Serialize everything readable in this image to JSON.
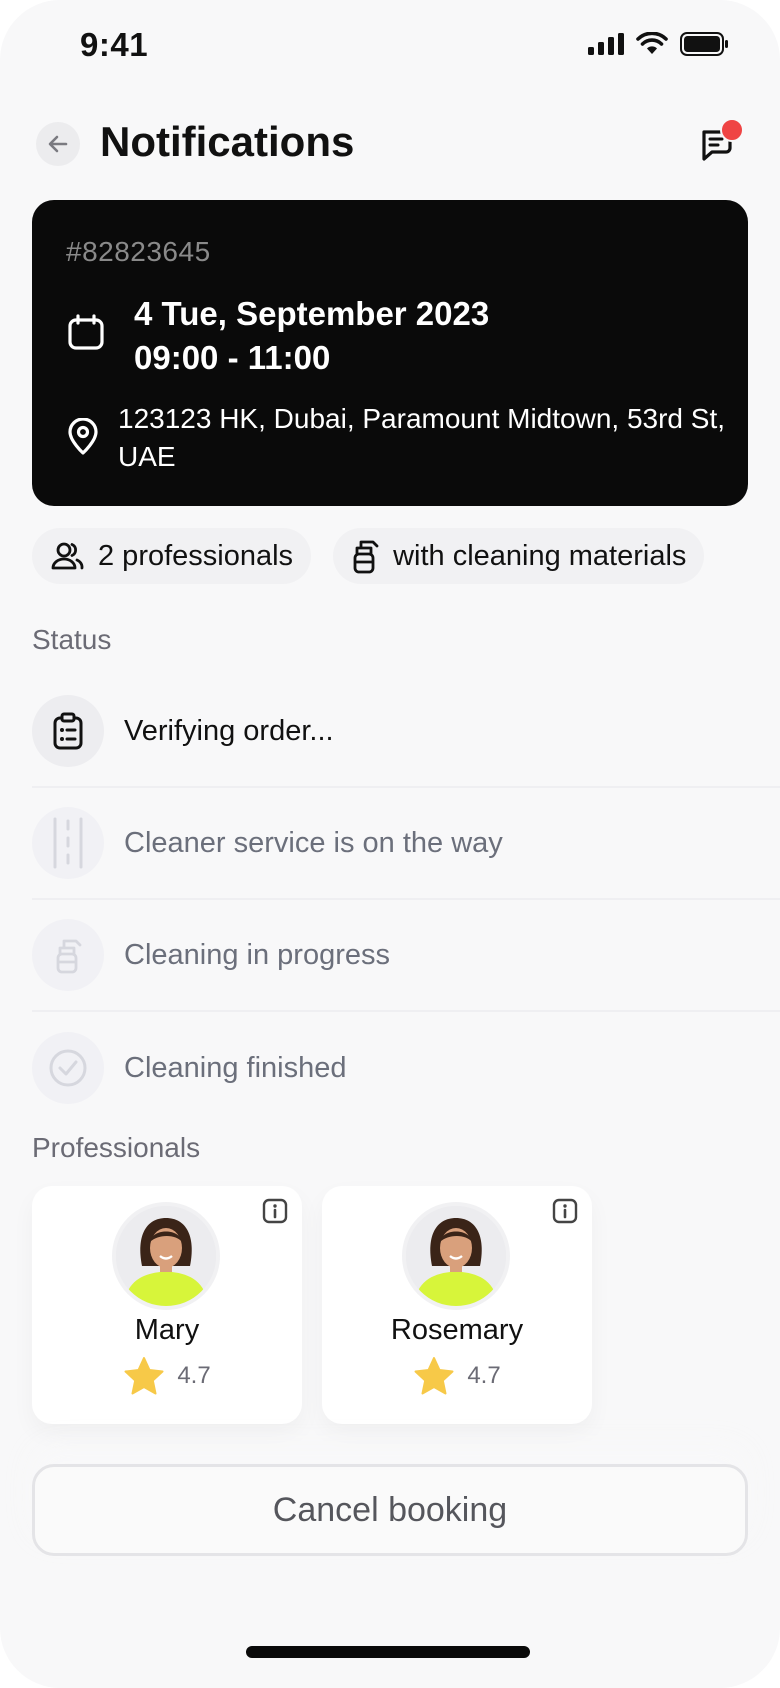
{
  "status_bar": {
    "time": "9:41"
  },
  "header": {
    "title": "Notifications",
    "has_unread": true
  },
  "booking": {
    "order_id": "#82823645",
    "date": "4 Tue, September 2023",
    "time": "09:00 - 11:00",
    "address": "123123 HK, Dubai, Paramount Midtown, 53rd St, UAE"
  },
  "chips": [
    {
      "icon": "users-icon",
      "label": "2 professionals"
    },
    {
      "icon": "spray-bottle-icon",
      "label": "with cleaning materials"
    }
  ],
  "status_section": {
    "label": "Status",
    "steps": [
      {
        "icon": "clipboard-icon",
        "label": "Verifying order...",
        "active": true
      },
      {
        "icon": "road-icon",
        "label": "Cleaner service is on the way",
        "active": false
      },
      {
        "icon": "spray-bottle-icon",
        "label": "Cleaning in progress",
        "active": false
      },
      {
        "icon": "check-circle-icon",
        "label": "Cleaning finished",
        "active": false
      }
    ]
  },
  "professionals_section": {
    "label": "Professionals",
    "items": [
      {
        "name": "Mary",
        "rating": "4.7"
      },
      {
        "name": "Rosemary",
        "rating": "4.7"
      }
    ]
  },
  "cancel_label": "Cancel booking",
  "colors": {
    "background": "#f8f8f9",
    "card_dark": "#0a0a0a",
    "notification_dot": "#ef4444",
    "star": "#f7c948",
    "avatar_shirt": "#d7f53a"
  }
}
